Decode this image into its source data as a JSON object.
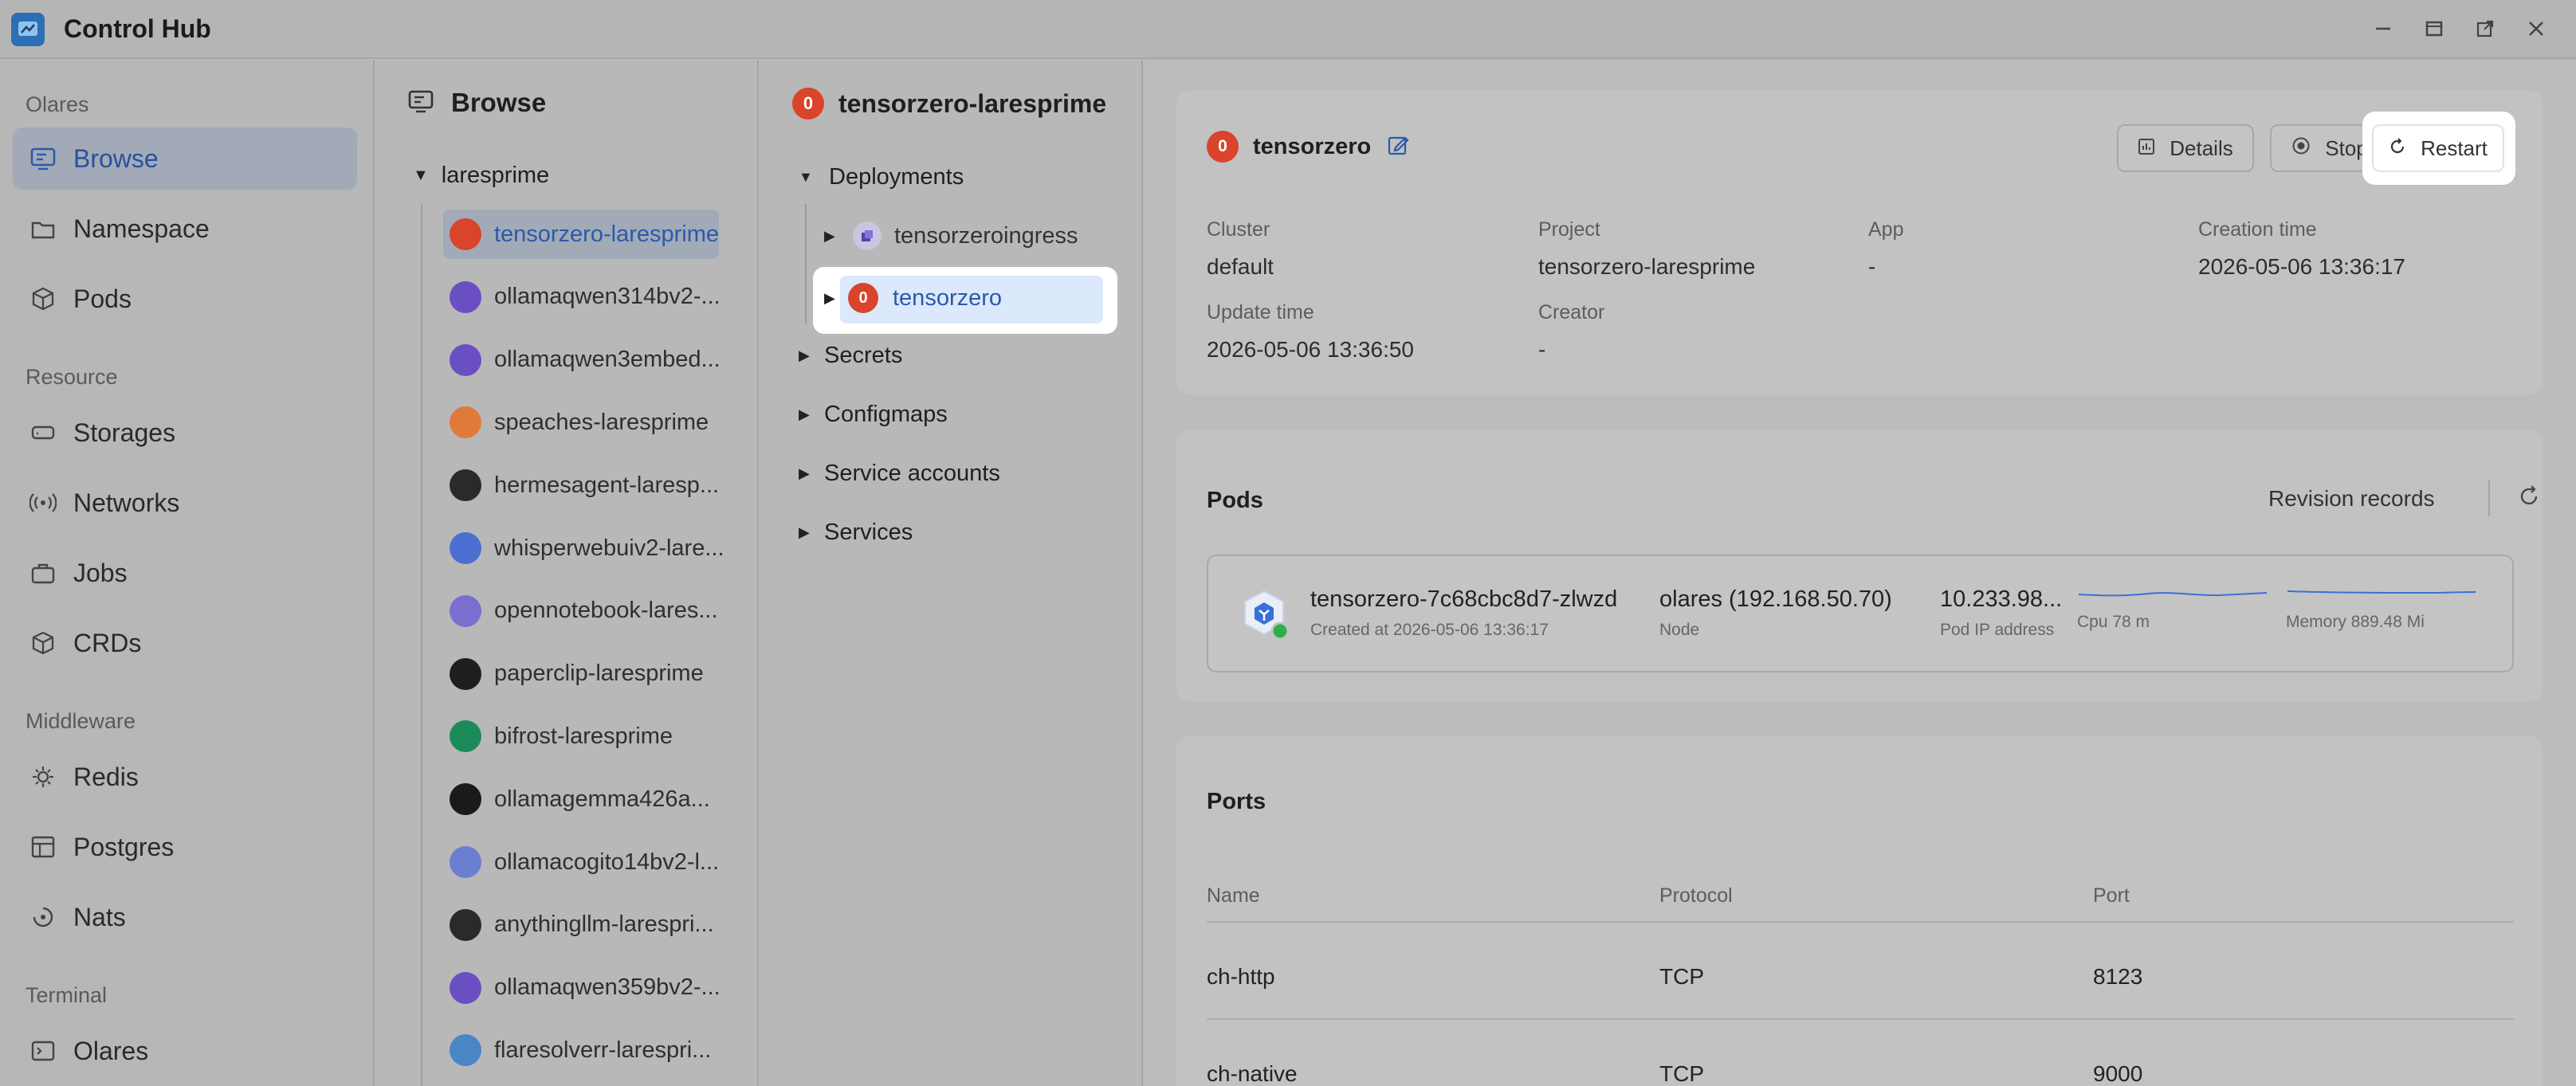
{
  "window": {
    "title": "Control Hub"
  },
  "sidebar": {
    "sections": [
      {
        "label": "Olares",
        "items": [
          {
            "label": "Browse",
            "icon": "browse-icon",
            "active": true
          },
          {
            "label": "Namespace",
            "icon": "namespace-icon"
          },
          {
            "label": "Pods",
            "icon": "pods-icon"
          }
        ]
      },
      {
        "label": "Resource",
        "items": [
          {
            "label": "Storages",
            "icon": "storage-icon"
          },
          {
            "label": "Networks",
            "icon": "network-icon"
          },
          {
            "label": "Jobs",
            "icon": "jobs-icon"
          },
          {
            "label": "CRDs",
            "icon": "crds-icon"
          }
        ]
      },
      {
        "label": "Middleware",
        "items": [
          {
            "label": "Redis",
            "icon": "redis-icon"
          },
          {
            "label": "Postgres",
            "icon": "postgres-icon"
          },
          {
            "label": "Nats",
            "icon": "nats-icon"
          }
        ]
      },
      {
        "label": "Terminal",
        "items": [
          {
            "label": "Olares",
            "icon": "terminal-icon"
          }
        ]
      }
    ]
  },
  "browse": {
    "title": "Browse",
    "namespace": "laresprime",
    "apps": [
      {
        "label": "tensorzero-laresprime",
        "color": "#d9442b",
        "selected": true
      },
      {
        "label": "ollamaqwen314bv2-...",
        "color": "#6a4fc2"
      },
      {
        "label": "ollamaqwen3embed...",
        "color": "#6a4fc2"
      },
      {
        "label": "speaches-laresprime",
        "color": "#e07a3a"
      },
      {
        "label": "hermesagent-laresp...",
        "color": "#2a2a2a"
      },
      {
        "label": "whisperwebuiv2-lare...",
        "color": "#4b6fd1"
      },
      {
        "label": "opennotebook-lares...",
        "color": "#7a6fd1"
      },
      {
        "label": "paperclip-laresprime",
        "color": "#1f1f1f"
      },
      {
        "label": "bifrost-laresprime",
        "color": "#1d8a5a"
      },
      {
        "label": "ollamagemma426a...",
        "color": "#1a1a1a"
      },
      {
        "label": "ollamacogito14bv2-l...",
        "color": "#6a7fd1"
      },
      {
        "label": "anythingllm-larespri...",
        "color": "#2a2a2a"
      },
      {
        "label": "ollamaqwen359bv2-...",
        "color": "#6a4fc2"
      },
      {
        "label": "flaresolverr-larespri...",
        "color": "#4a86c5"
      }
    ]
  },
  "tree": {
    "title": "tensorzero-laresprime",
    "deployments_label": "Deployments",
    "children": [
      {
        "label": "tensorzeroingress"
      },
      {
        "label": "tensorzero",
        "selected": true
      }
    ],
    "secrets_label": "Secrets",
    "configmaps_label": "Configmaps",
    "service_accounts_label": "Service accounts",
    "services_label": "Services"
  },
  "detail": {
    "name": "tensorzero",
    "buttons": {
      "details": "Details",
      "stop": "Stop",
      "restart": "Restart"
    },
    "meta": [
      {
        "key": "Cluster",
        "value": "default"
      },
      {
        "key": "Project",
        "value": "tensorzero-laresprime"
      },
      {
        "key": "App",
        "value": "-"
      },
      {
        "key": "Creation time",
        "value": "2026-05-06 13:36:17"
      },
      {
        "key": "Update time",
        "value": "2026-05-06 13:36:50"
      },
      {
        "key": "Creator",
        "value": "-"
      }
    ]
  },
  "pods": {
    "title": "Pods",
    "revision_records": "Revision records",
    "pod": {
      "name": "tensorzero-7c68cbc8d7-zlwzd",
      "created": "Created at 2026-05-06 13:36:17",
      "node": "olares (192.168.50.70)",
      "node_label": "Node",
      "ip": "10.233.98...",
      "ip_label": "Pod IP address",
      "cpu_label": "Cpu 78 m",
      "memory_label": "Memory 889.48 Mi"
    }
  },
  "ports": {
    "title": "Ports",
    "columns": [
      "Name",
      "Protocol",
      "Port"
    ],
    "rows": [
      [
        "ch-http",
        "TCP",
        "8123"
      ],
      [
        "ch-native",
        "TCP",
        "9000"
      ]
    ]
  },
  "colors": {
    "accent": "#2b5aa8",
    "tensorzero": "#d9442b",
    "status_ok": "#2fae4a"
  }
}
